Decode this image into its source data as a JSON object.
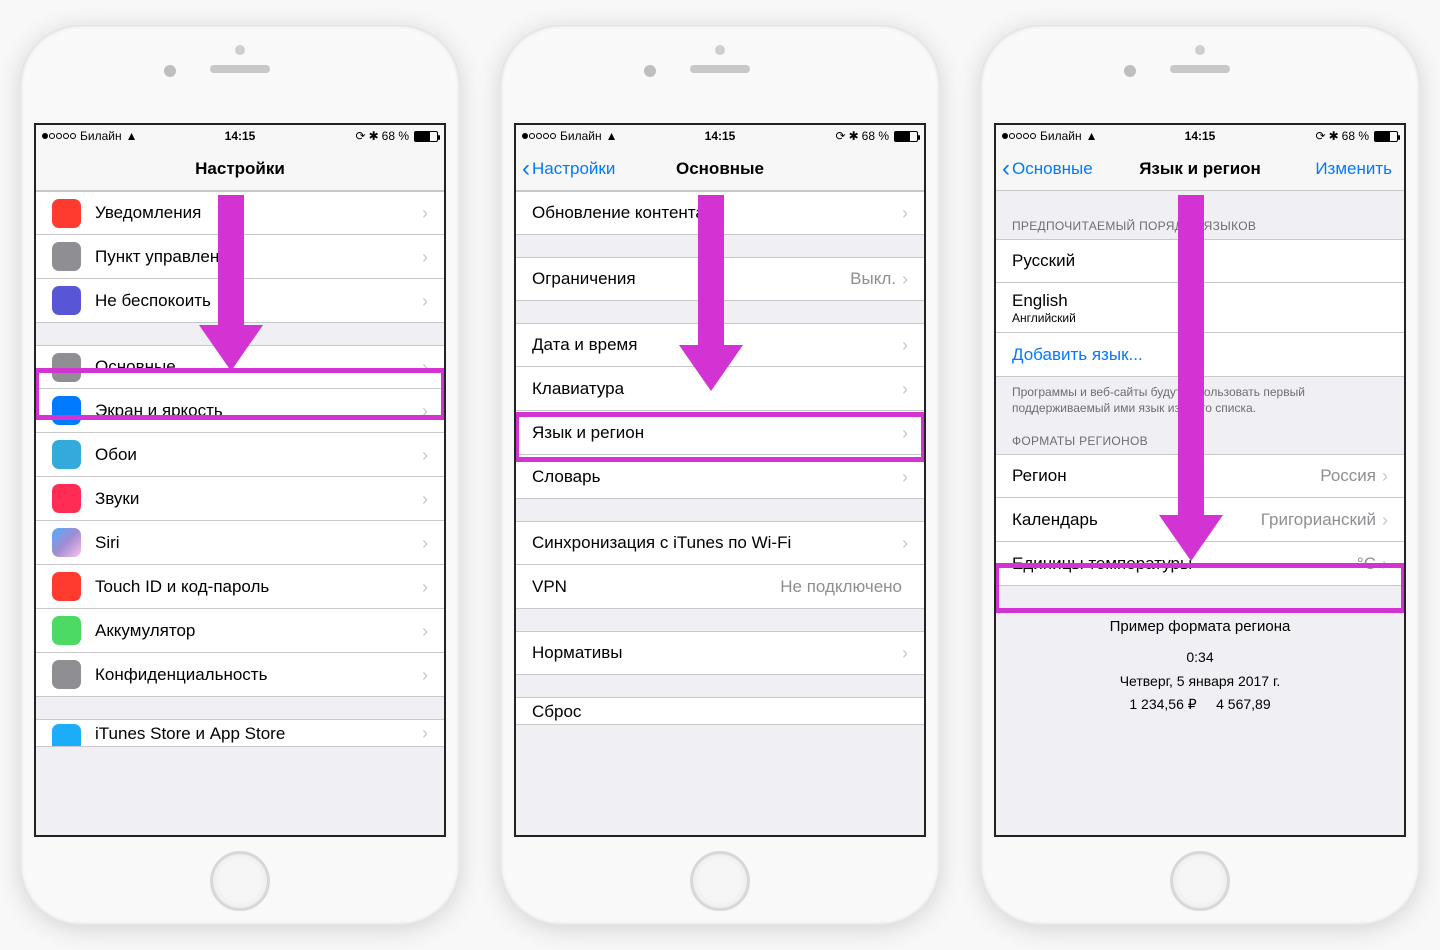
{
  "status": {
    "carrier": "Билайн",
    "time": "14:15",
    "battery_percent": "68 %"
  },
  "phone1": {
    "title": "Настройки",
    "rows_g1": [
      {
        "icon": "ic-red",
        "name": "bell-icon",
        "label": "Уведомления"
      },
      {
        "icon": "ic-grey",
        "name": "switch-icon",
        "label": "Пункт управления"
      },
      {
        "icon": "ic-purple",
        "name": "moon-icon",
        "label": "Не беспокоить"
      }
    ],
    "rows_g2": [
      {
        "icon": "ic-gear",
        "name": "gear-icon",
        "label": "Основные"
      },
      {
        "icon": "ic-blue",
        "name": "text-size-icon",
        "label": "Экран и яркость"
      },
      {
        "icon": "ic-cyan",
        "name": "flower-icon",
        "label": "Обои"
      },
      {
        "icon": "ic-pink",
        "name": "speaker-icon",
        "label": "Звуки"
      },
      {
        "icon": "ic-siri",
        "name": "siri-icon",
        "label": "Siri"
      },
      {
        "icon": "ic-touch",
        "name": "fingerprint-icon",
        "label": "Touch ID и код-пароль"
      },
      {
        "icon": "ic-green",
        "name": "battery-icon",
        "label": "Аккумулятор"
      },
      {
        "icon": "ic-hand",
        "name": "hand-icon",
        "label": "Конфиденциальность"
      }
    ],
    "rows_g3": [
      {
        "icon": "ic-store",
        "name": "appstore-icon",
        "label": "iTunes Store и App Store"
      }
    ]
  },
  "phone2": {
    "back": "Настройки",
    "title": "Основные",
    "rows_g0": [
      {
        "label": "Обновление контента"
      }
    ],
    "rows_g1": [
      {
        "label": "Ограничения",
        "value": "Выкл."
      }
    ],
    "rows_g2": [
      {
        "label": "Дата и время"
      },
      {
        "label": "Клавиатура"
      },
      {
        "label": "Язык и регион"
      },
      {
        "label": "Словарь"
      }
    ],
    "rows_g3": [
      {
        "label": "Синхронизация с iTunes по Wi-Fi"
      },
      {
        "label": "VPN",
        "value": "Не подключено"
      }
    ],
    "rows_g4": [
      {
        "label": "Нормативы"
      }
    ],
    "rows_g5_partial": "Сброс"
  },
  "phone3": {
    "back": "Основные",
    "title": "Язык и регион",
    "right": "Изменить",
    "lang_header": "ПРЕДПОЧИТАЕМЫЙ ПОРЯДОК ЯЗЫКОВ",
    "lang_rows": [
      {
        "label": "Русский"
      },
      {
        "label": "English",
        "sub": "Английский"
      }
    ],
    "add_language": "Добавить язык...",
    "lang_footer": "Программы и веб-сайты будут использовать первый поддерживаемый ими язык из этого списка.",
    "fmt_header": "ФОРМАТЫ РЕГИОНОВ",
    "fmt_rows": [
      {
        "label": "Регион",
        "value": "Россия"
      },
      {
        "label": "Календарь",
        "value": "Григорианский"
      },
      {
        "label": "Единицы температуры",
        "value": "°C"
      }
    ],
    "preview": {
      "title": "Пример формата региона",
      "time": "0:34",
      "date": "Четверг, 5 января 2017 г.",
      "numbers": "1 234,56 ₽     4 567,89"
    }
  }
}
